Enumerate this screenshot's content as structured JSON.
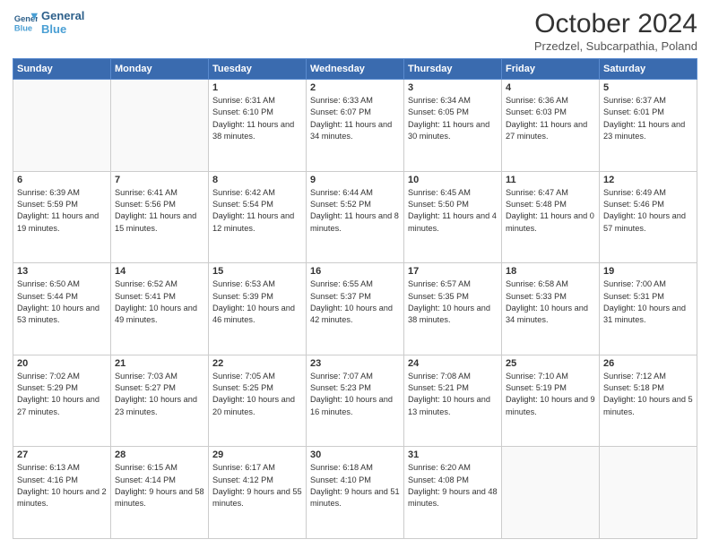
{
  "header": {
    "logo": {
      "line1": "General",
      "line2": "Blue"
    },
    "title": "October 2024",
    "subtitle": "Przedzel, Subcarpathia, Poland"
  },
  "days_of_week": [
    "Sunday",
    "Monday",
    "Tuesday",
    "Wednesday",
    "Thursday",
    "Friday",
    "Saturday"
  ],
  "weeks": [
    [
      {
        "day": "",
        "info": ""
      },
      {
        "day": "",
        "info": ""
      },
      {
        "day": "1",
        "info": "Sunrise: 6:31 AM\nSunset: 6:10 PM\nDaylight: 11 hours and 38 minutes."
      },
      {
        "day": "2",
        "info": "Sunrise: 6:33 AM\nSunset: 6:07 PM\nDaylight: 11 hours and 34 minutes."
      },
      {
        "day": "3",
        "info": "Sunrise: 6:34 AM\nSunset: 6:05 PM\nDaylight: 11 hours and 30 minutes."
      },
      {
        "day": "4",
        "info": "Sunrise: 6:36 AM\nSunset: 6:03 PM\nDaylight: 11 hours and 27 minutes."
      },
      {
        "day": "5",
        "info": "Sunrise: 6:37 AM\nSunset: 6:01 PM\nDaylight: 11 hours and 23 minutes."
      }
    ],
    [
      {
        "day": "6",
        "info": "Sunrise: 6:39 AM\nSunset: 5:59 PM\nDaylight: 11 hours and 19 minutes."
      },
      {
        "day": "7",
        "info": "Sunrise: 6:41 AM\nSunset: 5:56 PM\nDaylight: 11 hours and 15 minutes."
      },
      {
        "day": "8",
        "info": "Sunrise: 6:42 AM\nSunset: 5:54 PM\nDaylight: 11 hours and 12 minutes."
      },
      {
        "day": "9",
        "info": "Sunrise: 6:44 AM\nSunset: 5:52 PM\nDaylight: 11 hours and 8 minutes."
      },
      {
        "day": "10",
        "info": "Sunrise: 6:45 AM\nSunset: 5:50 PM\nDaylight: 11 hours and 4 minutes."
      },
      {
        "day": "11",
        "info": "Sunrise: 6:47 AM\nSunset: 5:48 PM\nDaylight: 11 hours and 0 minutes."
      },
      {
        "day": "12",
        "info": "Sunrise: 6:49 AM\nSunset: 5:46 PM\nDaylight: 10 hours and 57 minutes."
      }
    ],
    [
      {
        "day": "13",
        "info": "Sunrise: 6:50 AM\nSunset: 5:44 PM\nDaylight: 10 hours and 53 minutes."
      },
      {
        "day": "14",
        "info": "Sunrise: 6:52 AM\nSunset: 5:41 PM\nDaylight: 10 hours and 49 minutes."
      },
      {
        "day": "15",
        "info": "Sunrise: 6:53 AM\nSunset: 5:39 PM\nDaylight: 10 hours and 46 minutes."
      },
      {
        "day": "16",
        "info": "Sunrise: 6:55 AM\nSunset: 5:37 PM\nDaylight: 10 hours and 42 minutes."
      },
      {
        "day": "17",
        "info": "Sunrise: 6:57 AM\nSunset: 5:35 PM\nDaylight: 10 hours and 38 minutes."
      },
      {
        "day": "18",
        "info": "Sunrise: 6:58 AM\nSunset: 5:33 PM\nDaylight: 10 hours and 34 minutes."
      },
      {
        "day": "19",
        "info": "Sunrise: 7:00 AM\nSunset: 5:31 PM\nDaylight: 10 hours and 31 minutes."
      }
    ],
    [
      {
        "day": "20",
        "info": "Sunrise: 7:02 AM\nSunset: 5:29 PM\nDaylight: 10 hours and 27 minutes."
      },
      {
        "day": "21",
        "info": "Sunrise: 7:03 AM\nSunset: 5:27 PM\nDaylight: 10 hours and 23 minutes."
      },
      {
        "day": "22",
        "info": "Sunrise: 7:05 AM\nSunset: 5:25 PM\nDaylight: 10 hours and 20 minutes."
      },
      {
        "day": "23",
        "info": "Sunrise: 7:07 AM\nSunset: 5:23 PM\nDaylight: 10 hours and 16 minutes."
      },
      {
        "day": "24",
        "info": "Sunrise: 7:08 AM\nSunset: 5:21 PM\nDaylight: 10 hours and 13 minutes."
      },
      {
        "day": "25",
        "info": "Sunrise: 7:10 AM\nSunset: 5:19 PM\nDaylight: 10 hours and 9 minutes."
      },
      {
        "day": "26",
        "info": "Sunrise: 7:12 AM\nSunset: 5:18 PM\nDaylight: 10 hours and 5 minutes."
      }
    ],
    [
      {
        "day": "27",
        "info": "Sunrise: 6:13 AM\nSunset: 4:16 PM\nDaylight: 10 hours and 2 minutes."
      },
      {
        "day": "28",
        "info": "Sunrise: 6:15 AM\nSunset: 4:14 PM\nDaylight: 9 hours and 58 minutes."
      },
      {
        "day": "29",
        "info": "Sunrise: 6:17 AM\nSunset: 4:12 PM\nDaylight: 9 hours and 55 minutes."
      },
      {
        "day": "30",
        "info": "Sunrise: 6:18 AM\nSunset: 4:10 PM\nDaylight: 9 hours and 51 minutes."
      },
      {
        "day": "31",
        "info": "Sunrise: 6:20 AM\nSunset: 4:08 PM\nDaylight: 9 hours and 48 minutes."
      },
      {
        "day": "",
        "info": ""
      },
      {
        "day": "",
        "info": ""
      }
    ]
  ]
}
